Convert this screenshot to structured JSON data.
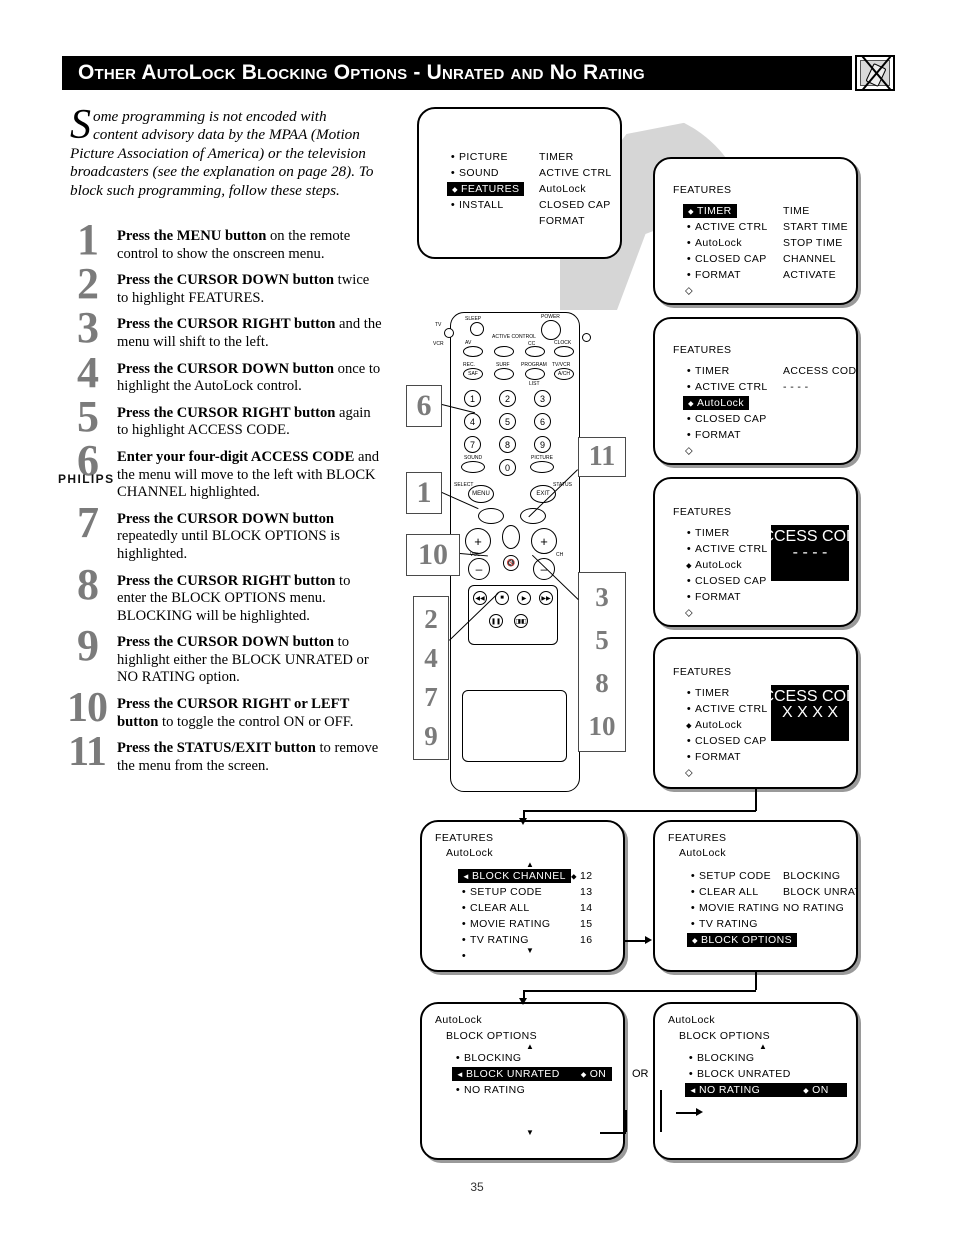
{
  "header": {
    "title": "Other AutoLock Blocking Options - Unrated and No Rating",
    "icon": "tv-remote-icon"
  },
  "intro": {
    "dropcap": "S",
    "text": "ome programming is not encoded with content advisory data by  the MPAA (Motion Picture Association of America) or the television broadcasters (see the explanation on page 28). To block such programming, follow these steps."
  },
  "steps": [
    {
      "number": "1",
      "bold": "Press the MENU button",
      "rest": " on the remote control to show the onscreen menu."
    },
    {
      "number": "2",
      "bold": "Press the CURSOR DOWN button",
      "rest": " twice to highlight FEATURES."
    },
    {
      "number": "3",
      "bold": "Press the CURSOR RIGHT button",
      "rest": " and the menu will shift to the left."
    },
    {
      "number": "4",
      "bold": "Press the CURSOR DOWN button",
      "rest": " once to highlight the AutoLock control."
    },
    {
      "number": "5",
      "bold": "Press the CURSOR RIGHT button",
      "rest": " again to highlight ACCESS CODE."
    },
    {
      "number": "6",
      "bold": "Enter your four-digit ACCESS CODE",
      "rest": " and the menu will move to the left with BLOCK CHANNEL highlighted."
    },
    {
      "number": "7",
      "bold": "Press the CURSOR DOWN button",
      "rest": " repeatedly until BLOCK OPTIONS is highlighted."
    },
    {
      "number": "8",
      "bold": "Press the CURSOR RIGHT button",
      "rest": " to enter the BLOCK OPTIONS menu. BLOCKING will be highlighted."
    },
    {
      "number": "9",
      "bold": "Press the CURSOR DOWN button",
      "rest": " to highlight either the BLOCK UNRATED or NO RATING option."
    },
    {
      "number": "10",
      "bold": "Press the CURSOR RIGHT or LEFT button",
      "rest": " to toggle the control ON or OFF."
    },
    {
      "number": "11",
      "bold": "Press the STATUS/EXIT button",
      "rest": " to remove the menu from the screen."
    }
  ],
  "screens": {
    "main_menu": {
      "left_items": [
        "PICTURE",
        "SOUND",
        "FEATURES",
        "INSTALL"
      ],
      "highlighted": "FEATURES",
      "right_items": [
        "TIMER",
        "ACTIVE CTRL",
        "AutoLock",
        "CLOSED CAP",
        "FORMAT"
      ]
    },
    "features_timer": {
      "title": "FEATURES",
      "left_items": [
        "TIMER",
        "ACTIVE CTRL",
        "AutoLock",
        "CLOSED CAP",
        "FORMAT"
      ],
      "highlighted": "TIMER",
      "right_items": [
        "TIME",
        "START TIME",
        "STOP TIME",
        "CHANNEL",
        "ACTIVATE"
      ]
    },
    "features_autolock": {
      "title": "FEATURES",
      "left_items": [
        "TIMER",
        "ACTIVE CTRL",
        "AutoLock",
        "CLOSED CAP",
        "FORMAT"
      ],
      "highlighted": "AutoLock",
      "right_label": "ACCESS CODE",
      "right_value": "- - - -"
    },
    "features_accesscode_empty": {
      "title": "FEATURES",
      "left_items": [
        "TIMER",
        "ACTIVE CTRL",
        "AutoLock",
        "CLOSED CAP",
        "FORMAT"
      ],
      "cursor_on": "AutoLock",
      "box_label": "ACCESS CODE",
      "box_value": "- - - -"
    },
    "features_accesscode_entered": {
      "title": "FEATURES",
      "left_items": [
        "TIMER",
        "ACTIVE CTRL",
        "AutoLock",
        "CLOSED CAP",
        "FORMAT"
      ],
      "cursor_on": "AutoLock",
      "box_label": "ACCESS CODE",
      "box_value": "X X X X"
    },
    "autolock_block_channel": {
      "title": "FEATURES",
      "subtitle": "AutoLock",
      "items": [
        "BLOCK CHANNEL",
        "SETUP CODE",
        "CLEAR ALL",
        "MOVIE RATING",
        "TV RATING"
      ],
      "values": [
        "12",
        "13",
        "14",
        "15",
        "16"
      ],
      "highlighted": "BLOCK CHANNEL"
    },
    "autolock_block_options": {
      "title": "FEATURES",
      "subtitle": "AutoLock",
      "items": [
        "SETUP CODE",
        "CLEAR ALL",
        "MOVIE RATING",
        "TV RATING",
        "BLOCK OPTIONS"
      ],
      "highlighted": "BLOCK OPTIONS",
      "right_items": [
        "BLOCKING",
        "BLOCK UNRATED",
        "NO RATING"
      ]
    },
    "block_unrated_on": {
      "title": "AutoLock",
      "subtitle": "BLOCK OPTIONS",
      "items": [
        "BLOCKING",
        "BLOCK UNRATED",
        "NO RATING"
      ],
      "highlighted": "BLOCK UNRATED",
      "highlighted_value": "ON"
    },
    "no_rating_on": {
      "title": "AutoLock",
      "subtitle": "BLOCK OPTIONS",
      "items": [
        "BLOCKING",
        "BLOCK UNRATED",
        "NO RATING"
      ],
      "highlighted": "NO RATING",
      "highlighted_value": "ON"
    }
  },
  "or_label": "OR",
  "remote": {
    "brand": "PHILIPS",
    "keys": {
      "sleep": "SLEEP",
      "power": "POWER",
      "tv": "TV",
      "vcr": "VCR",
      "av": "AV",
      "active_control": "ACTIVE CONTROL",
      "cc": "CC",
      "clock": "CLOCK",
      "rec": "REC.",
      "saf": "SAF",
      "surf": "SURF",
      "program": "PROGRAM",
      "list": "LIST",
      "tvvcr": "TV/VCR",
      "auch": "A/CH",
      "digits": [
        "1",
        "2",
        "3",
        "4",
        "5",
        "6",
        "7",
        "8",
        "9",
        "0"
      ],
      "sound": "SOUND",
      "picture": "PICTURE",
      "select": "SELECT",
      "menu": "MENU",
      "exit": "EXIT",
      "status": "STATUS",
      "vol": "VOL",
      "ch": "CH",
      "plus": "+",
      "minus": "–",
      "mute": "mute-icon"
    }
  },
  "callouts": {
    "left_6": "6",
    "left_1": "1",
    "left_10": "10",
    "left_group": [
      "2",
      "4",
      "7",
      "9"
    ],
    "right_11": "11",
    "right_group": [
      "3",
      "5",
      "8",
      "10"
    ]
  },
  "page_number": "35"
}
